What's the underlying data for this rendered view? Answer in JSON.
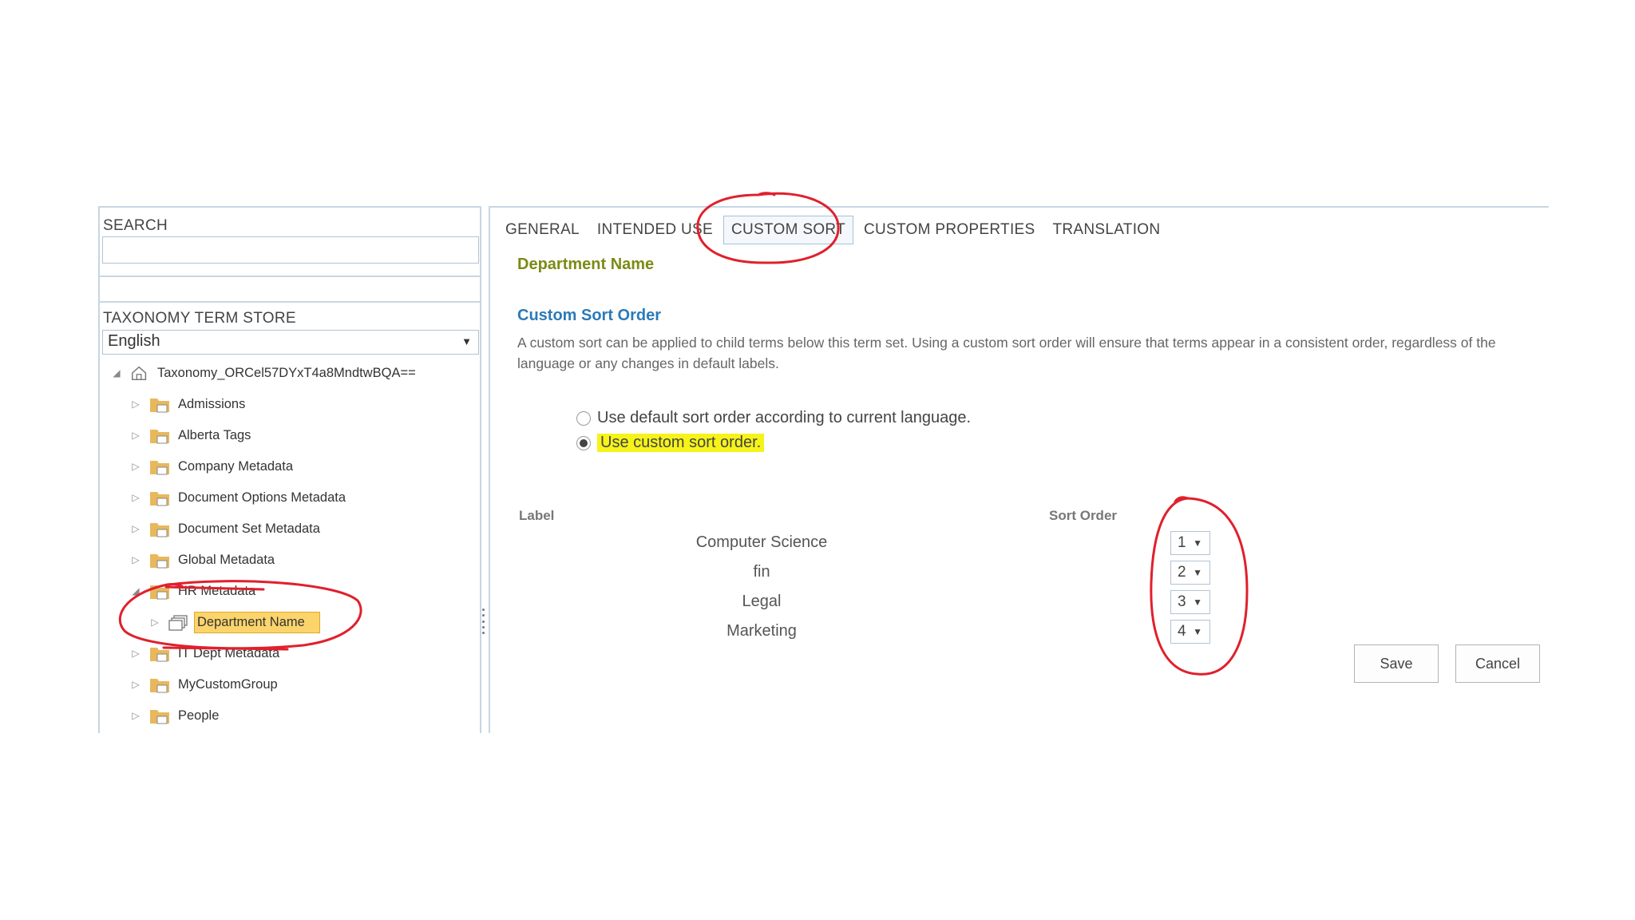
{
  "left_panel": {
    "search_label": "SEARCH",
    "search_value": "",
    "term_store_label": "TAXONOMY TERM STORE",
    "language": "English",
    "tree": {
      "root": "Taxonomy_ORCel57DYxT4a8MndtwBQA==",
      "groups": [
        "Admissions",
        "Alberta Tags",
        "Company Metadata",
        "Document Options Metadata",
        "Document Set Metadata",
        "Global Metadata",
        "HR Metadata",
        "IT Dept Metadata",
        "MyCustomGroup",
        "People"
      ],
      "selected_term_set": "Department Name"
    }
  },
  "tabs": [
    "GENERAL",
    "INTENDED USE",
    "CUSTOM SORT",
    "CUSTOM PROPERTIES",
    "TRANSLATION"
  ],
  "active_tab": "CUSTOM SORT",
  "content": {
    "term_set_name": "Department Name",
    "section_title": "Custom Sort Order",
    "description": "A custom sort can be applied to child terms below this term set. Using a custom sort order will ensure that terms appear in a consistent order, regardless of the language or any changes in default labels.",
    "radio_default": "Use default sort order according to current language.",
    "radio_custom": "Use custom sort order.",
    "selected_option": "custom",
    "table": {
      "col_label": "Label",
      "col_sort": "Sort Order",
      "rows": [
        {
          "label": "Computer Science",
          "order": "1"
        },
        {
          "label": "fin",
          "order": "2"
        },
        {
          "label": "Legal",
          "order": "3"
        },
        {
          "label": "Marketing",
          "order": "4"
        }
      ]
    },
    "save_label": "Save",
    "cancel_label": "Cancel"
  },
  "colors": {
    "term_title": "#7c8b13",
    "section_title": "#2b7ab8",
    "highlight_yellow": "#f6f31a",
    "selected_term_bg": "#fbd46b",
    "folder": "#e8b85c",
    "annotation_red": "#e0202c"
  }
}
